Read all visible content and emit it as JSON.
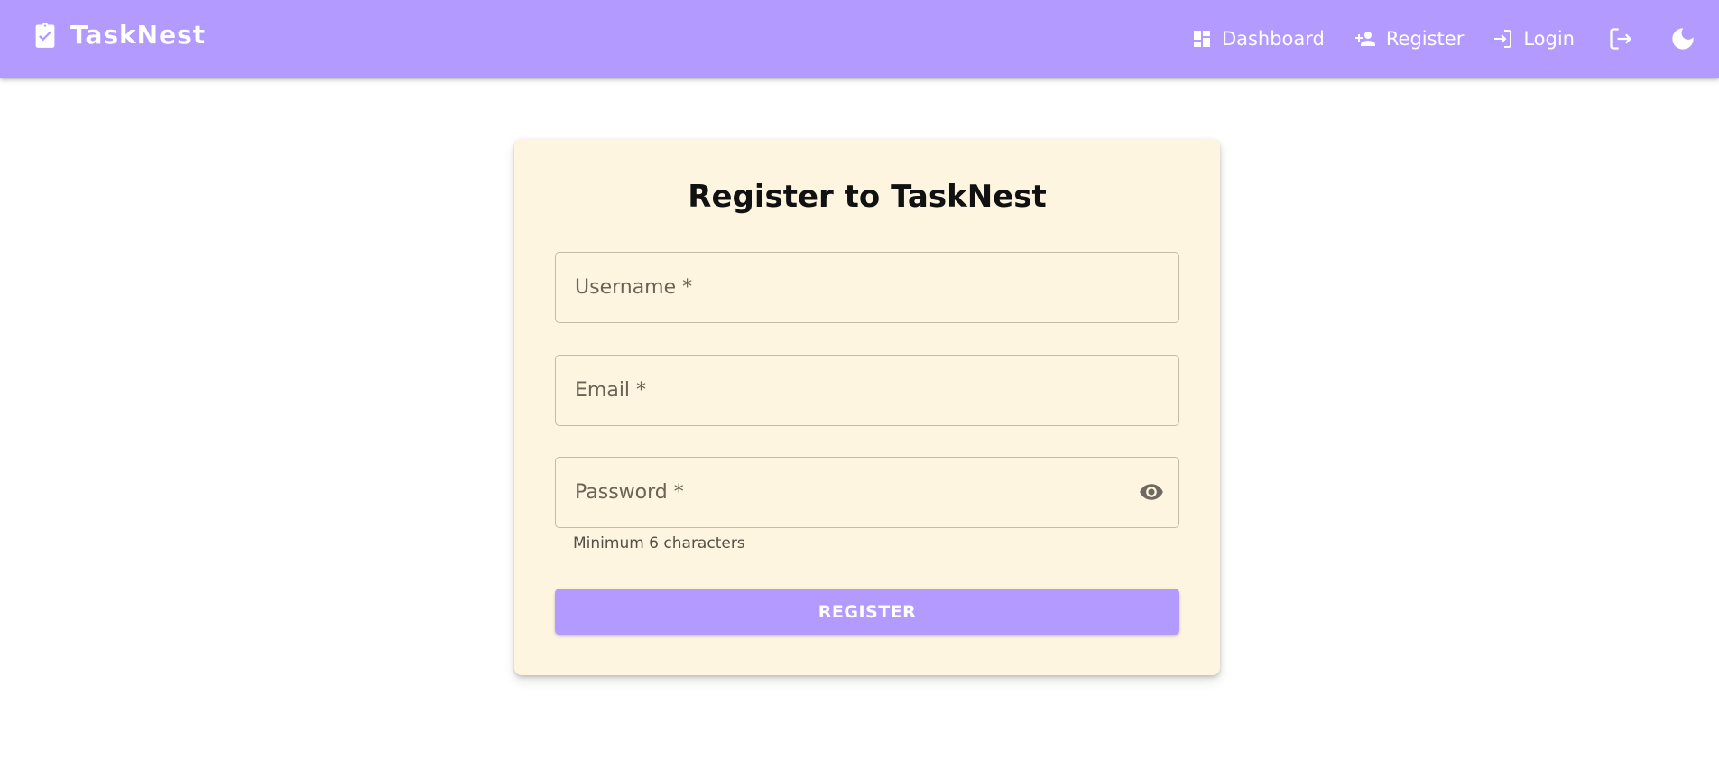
{
  "app": {
    "title": "TaskNest",
    "accent_color": "#b39aff",
    "card_color": "#fdf5e0"
  },
  "nav": {
    "items": [
      {
        "label": "Dashboard",
        "icon": "dashboard-icon"
      },
      {
        "label": "Register",
        "icon": "person-add-icon"
      },
      {
        "label": "Login",
        "icon": "login-icon"
      }
    ],
    "logout_icon": "logout-icon",
    "theme_icon": "dark-mode-moon-icon"
  },
  "form": {
    "title": "Register to TaskNest",
    "username_placeholder": "Username *",
    "email_placeholder": "Email *",
    "password_placeholder": "Password *",
    "password_helper": "Minimum 6 characters",
    "submit_label": "REGISTER",
    "password_toggle_icon": "visibility-eye-icon"
  }
}
